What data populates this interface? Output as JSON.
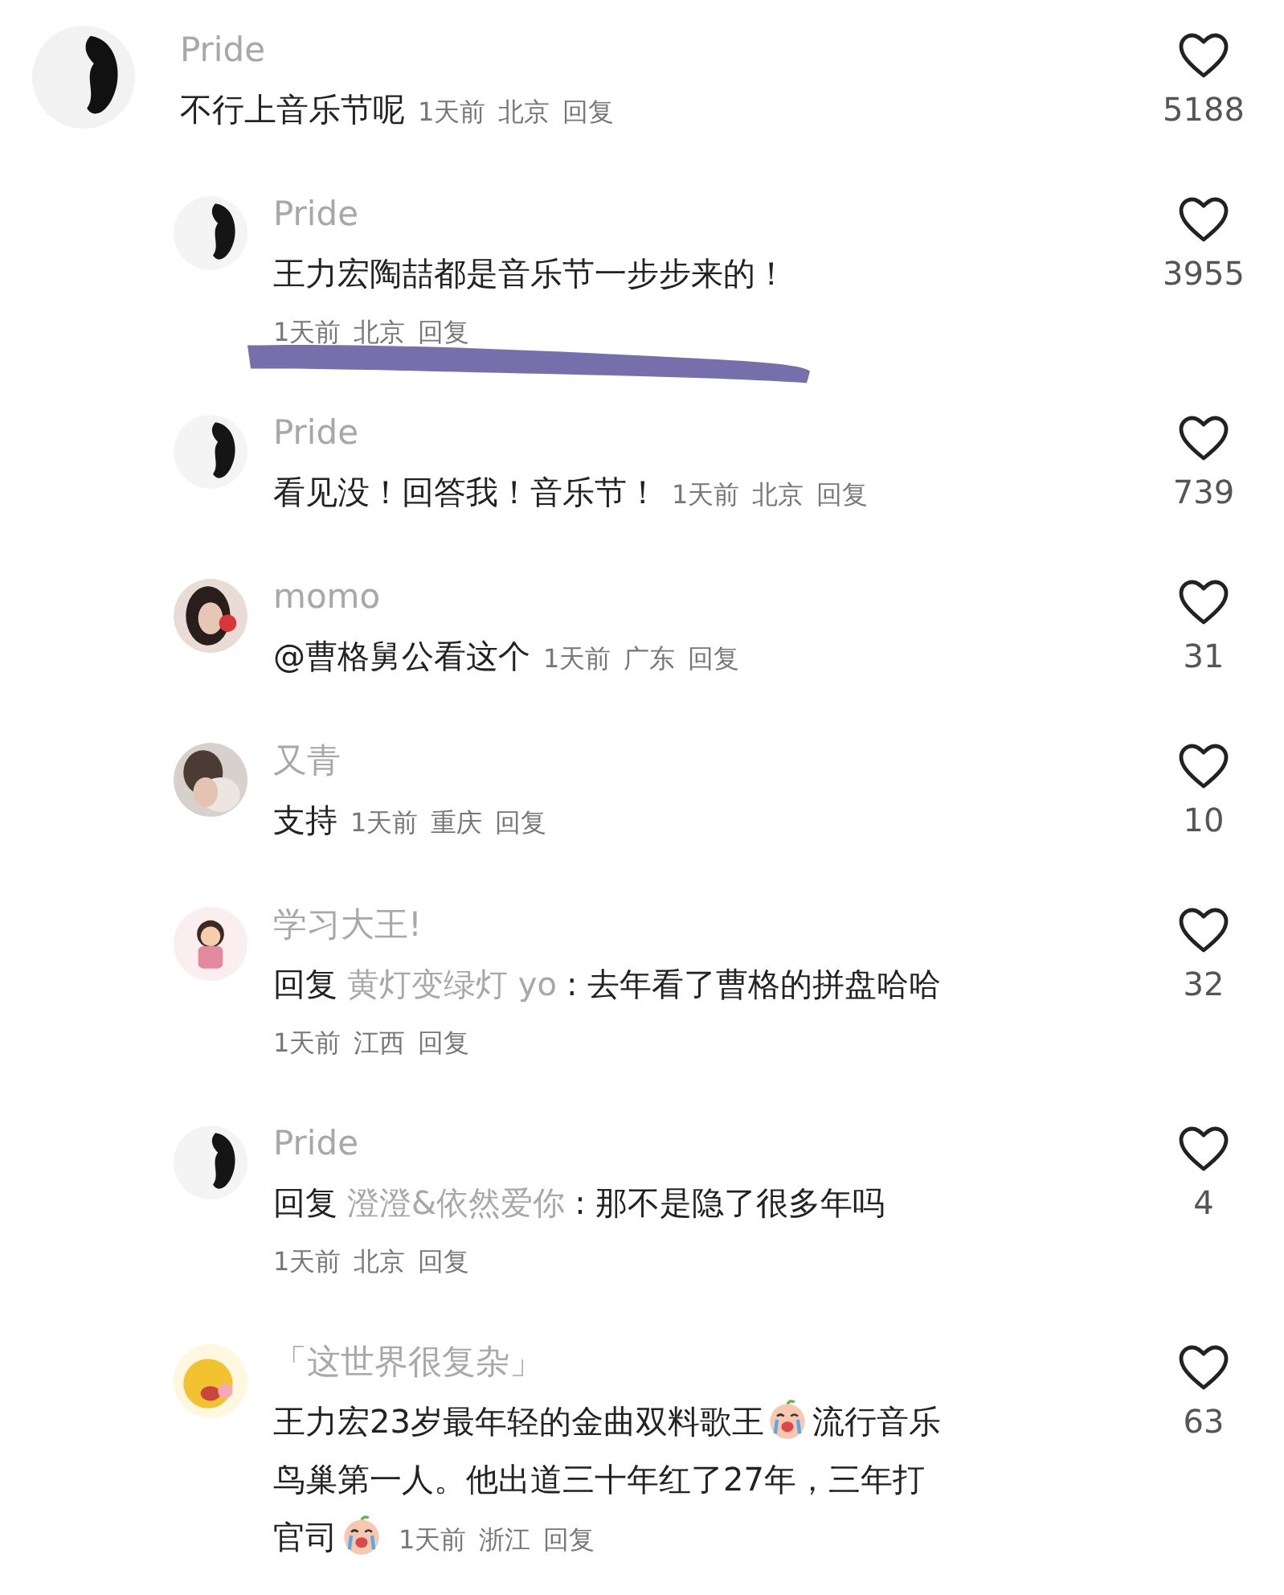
{
  "comments": [
    {
      "reply": false,
      "author": "Pride",
      "body": [
        {
          "kind": "text",
          "text": "不行上音乐节呢"
        }
      ],
      "meta_below": false,
      "time": "1天前",
      "location": "北京",
      "reply_label": "回复",
      "likes": "5188",
      "scribbled": false
    },
    {
      "reply": true,
      "author": "Pride",
      "body": [
        {
          "kind": "text",
          "text": "王力宏陶喆都是音乐节一步步来的！"
        }
      ],
      "meta_below": true,
      "time": "1天前",
      "location": "北京",
      "reply_label": "回复",
      "likes": "3955",
      "scribbled": true
    },
    {
      "reply": true,
      "author": "Pride",
      "body": [
        {
          "kind": "text",
          "text": "看见没！回答我！音乐节！"
        }
      ],
      "meta_below": false,
      "time": "1天前",
      "location": "北京",
      "reply_label": "回复",
      "likes": "739",
      "scribbled": false
    },
    {
      "reply": true,
      "author": "momo",
      "body": [
        {
          "kind": "text",
          "text": "@曹格舅公看这个"
        }
      ],
      "meta_below": false,
      "time": "1天前",
      "location": "广东",
      "reply_label": "回复",
      "likes": "31",
      "scribbled": false
    },
    {
      "reply": true,
      "author": "又青",
      "body": [
        {
          "kind": "text",
          "text": "支持"
        }
      ],
      "meta_below": false,
      "time": "1天前",
      "location": "重庆",
      "reply_label": "回复",
      "likes": "10",
      "scribbled": false
    },
    {
      "reply": true,
      "author": "学习大王!",
      "body": [
        {
          "kind": "prefix",
          "text": "回复"
        },
        {
          "kind": "mention",
          "text": "黄灯变绿灯 yo"
        },
        {
          "kind": "text",
          "text": ": 去年看了曹格的拼盘哈哈"
        }
      ],
      "meta_below": true,
      "time": "1天前",
      "location": "江西",
      "reply_label": "回复",
      "likes": "32",
      "scribbled": false
    },
    {
      "reply": true,
      "author": "Pride",
      "body": [
        {
          "kind": "prefix",
          "text": "回复"
        },
        {
          "kind": "mention",
          "text": "澄澄&依然爱你"
        },
        {
          "kind": "text",
          "text": ": 那不是隐了很多年吗"
        }
      ],
      "meta_below": true,
      "time": "1天前",
      "location": "北京",
      "reply_label": "回复",
      "likes": "4",
      "scribbled": false
    },
    {
      "reply": true,
      "author": "「这世界很复杂」",
      "body": [
        {
          "kind": "text",
          "text": "王力宏23岁最年轻的金曲双料歌王"
        },
        {
          "kind": "emoji"
        },
        {
          "kind": "text",
          "text": "流行音乐"
        },
        {
          "kind": "break"
        },
        {
          "kind": "text",
          "text": "鸟巢第一人。他出道三十年红了27年，三年打"
        },
        {
          "kind": "break"
        },
        {
          "kind": "text",
          "text": "官司"
        },
        {
          "kind": "emoji"
        }
      ],
      "meta_below": false,
      "time": "1天前",
      "location": "浙江",
      "reply_label": "回复",
      "likes": "63",
      "scribbled": false
    }
  ]
}
